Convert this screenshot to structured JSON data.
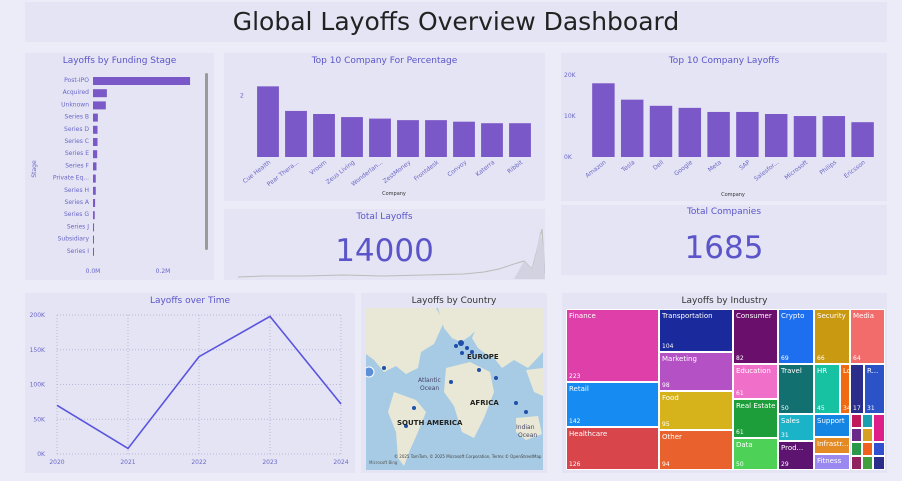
{
  "title": "Global Layoffs Overview Dashboard",
  "colors": {
    "primary": "#7b58c8",
    "title_text": "#5b55c9",
    "card": "#e4e4f4",
    "page": "#ececf8"
  },
  "funding": {
    "title": "Layoffs by Funding Stage",
    "ylabel": "Stage",
    "xticks": [
      "0.0M",
      "0.2M"
    ],
    "chart_data": {
      "type": "bar",
      "orientation": "horizontal",
      "categories": [
        "Post-IPO",
        "Acquired",
        "Unknown",
        "Series B",
        "Series D",
        "Series C",
        "Series E",
        "Series F",
        "Private Eq...",
        "Series H",
        "Series A",
        "Series G",
        "Series J",
        "Subsidiary",
        "Series I"
      ],
      "values": [
        280000,
        40000,
        37000,
        14000,
        13000,
        13000,
        12000,
        10000,
        8000,
        8000,
        6000,
        5000,
        3000,
        2000,
        1000
      ],
      "xlim": [
        0,
        300000
      ],
      "ylabel": "Stage"
    }
  },
  "pct": {
    "title": "Top 10 Company For Percentage",
    "xlabel": "Company",
    "ytick": "2",
    "chart_data": {
      "type": "bar",
      "categories": [
        "Cue Health",
        "Pear Thera...",
        "Vroom",
        "Zeus Living",
        "Wonderlan...",
        "ZestMoney",
        "Frontdesk",
        "Convoy",
        "Katerra",
        "Ribbit"
      ],
      "values": [
        2.3,
        1.5,
        1.4,
        1.3,
        1.25,
        1.2,
        1.2,
        1.15,
        1.1,
        1.1
      ],
      "ylim": [
        0,
        2.8
      ]
    }
  },
  "company": {
    "title": "Top 10 Company Layoffs",
    "xlabel": "Company",
    "yticks": [
      "0K",
      "10K",
      "20K"
    ],
    "chart_data": {
      "type": "bar",
      "categories": [
        "Amazon",
        "Tesla",
        "Dell",
        "Google",
        "Meta",
        "SAP",
        "Salesfor...",
        "Microsoft",
        "Philips",
        "Ericsson"
      ],
      "values": [
        18000,
        14000,
        12500,
        12000,
        11000,
        11000,
        10500,
        10000,
        10000,
        8500
      ],
      "ylim": [
        0,
        21000
      ]
    }
  },
  "total_layoffs": {
    "title": "Total Layoffs",
    "value": "14000"
  },
  "total_companies": {
    "title": "Total Companies",
    "value": "1685"
  },
  "time": {
    "title": "Layoffs over Time",
    "yticks": [
      "0K",
      "50K",
      "100K",
      "150K",
      "200K"
    ],
    "chart_data": {
      "type": "line",
      "x": [
        "2020",
        "2021",
        "2022",
        "2023",
        "2024"
      ],
      "values": [
        70000,
        8000,
        140000,
        198000,
        72000
      ],
      "ylim": [
        0,
        200000
      ]
    }
  },
  "country": {
    "title": "Layoffs by Country",
    "labels": {
      "europe": "EUROPE",
      "africa": "AFRICA",
      "south_america": "SOUTH AMERICA",
      "atlantic": "Atlantic",
      "ocean": "Ocean",
      "indian": "Indian",
      "ocean2": "Ocean"
    },
    "credits": "© 2025 TomTom, © 2025 Microsoft Corporation, Terms © OpenStreetMap",
    "logo": "Microsoft Bing"
  },
  "industry": {
    "title": "Layoffs by Industry",
    "chart_data": {
      "type": "treemap",
      "items": [
        {
          "name": "Finance",
          "value": "223",
          "color": "#de3fa8"
        },
        {
          "name": "Retail",
          "value": "142",
          "color": "#168bf2"
        },
        {
          "name": "Healthcare",
          "value": "126",
          "color": "#d8464b"
        },
        {
          "name": "Transportation",
          "value": "104",
          "color": "#1a2a9c"
        },
        {
          "name": "Marketing",
          "value": "98",
          "color": "#b451c4"
        },
        {
          "name": "Food",
          "value": "95",
          "color": "#d6b31a"
        },
        {
          "name": "Other",
          "value": "94",
          "color": "#e9612c"
        },
        {
          "name": "Consumer",
          "value": "82",
          "color": "#6b0f6d"
        },
        {
          "name": "Education",
          "value": "61",
          "color": "#f06fc9"
        },
        {
          "name": "Real Estate",
          "value": "61",
          "color": "#1d9e3a"
        },
        {
          "name": "Data",
          "value": "50",
          "color": "#4ed157"
        },
        {
          "name": "Crypto",
          "value": "69",
          "color": "#1e6ff0"
        },
        {
          "name": "Travel",
          "value": "50",
          "color": "#127070"
        },
        {
          "name": "Sales",
          "value": "31",
          "color": "#1ab3c8"
        },
        {
          "name": "Prod...",
          "value": "29",
          "color": "#5d1470"
        },
        {
          "name": "Security",
          "value": "66",
          "color": "#c99912"
        },
        {
          "name": "HR",
          "value": "45",
          "color": "#16c2a2"
        },
        {
          "name": "Lo...",
          "value": "34",
          "color": "#f06b10"
        },
        {
          "name": "Support",
          "value": "",
          "color": "#1485e3"
        },
        {
          "name": "Infrastr...",
          "value": "",
          "color": "#e38a25"
        },
        {
          "name": "Fitness",
          "value": "",
          "color": "#9a89f0"
        },
        {
          "name": "Media",
          "value": "64",
          "color": "#f36c6c"
        },
        {
          "name": "R...",
          "value": "31",
          "color": "#2c52c8"
        },
        {
          "name": "",
          "value": "17",
          "color": "#2a2e8a"
        }
      ]
    }
  }
}
